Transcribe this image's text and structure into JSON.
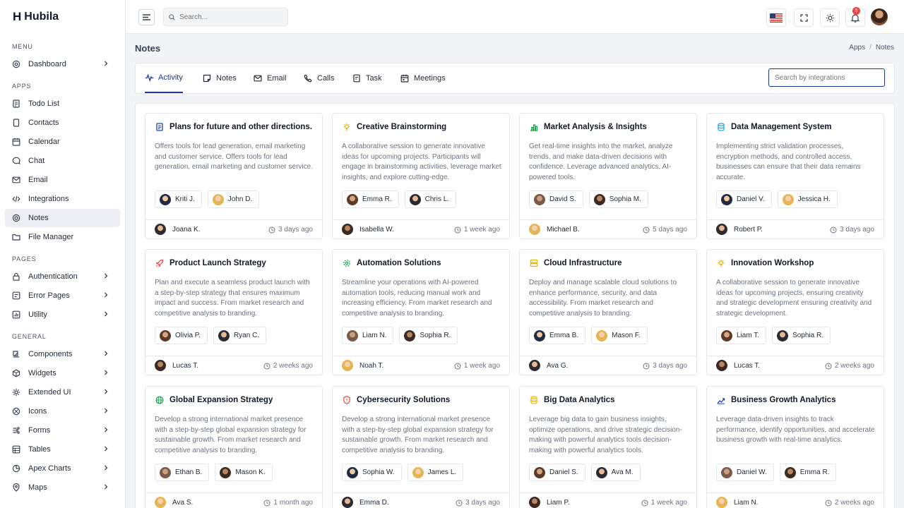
{
  "brand": {
    "name": "Hubila",
    "logo_glyph": "H"
  },
  "sidebar": {
    "sections": [
      {
        "label": "MENU",
        "items": [
          {
            "label": "Dashboard",
            "icon": "dashboard-icon",
            "chevron": true
          }
        ]
      },
      {
        "label": "APPS",
        "items": [
          {
            "label": "Todo List",
            "icon": "todo-icon",
            "chevron": false
          },
          {
            "label": "Contacts",
            "icon": "contacts-icon",
            "chevron": false
          },
          {
            "label": "Calendar",
            "icon": "calendar-icon",
            "chevron": false
          },
          {
            "label": "Chat",
            "icon": "chat-icon",
            "chevron": false
          },
          {
            "label": "Email",
            "icon": "email-icon",
            "chevron": false
          },
          {
            "label": "Integrations",
            "icon": "code-icon",
            "chevron": false
          },
          {
            "label": "Notes",
            "icon": "notes-icon",
            "chevron": false,
            "active": true
          },
          {
            "label": "File Manager",
            "icon": "folder-icon",
            "chevron": false
          }
        ]
      },
      {
        "label": "PAGES",
        "items": [
          {
            "label": "Authentication",
            "icon": "lock-icon",
            "chevron": true
          },
          {
            "label": "Error Pages",
            "icon": "error-icon",
            "chevron": true
          },
          {
            "label": "Utility",
            "icon": "utility-icon",
            "chevron": true
          }
        ]
      },
      {
        "label": "GENERAL",
        "items": [
          {
            "label": "Components",
            "icon": "components-icon",
            "chevron": true
          },
          {
            "label": "Widgets",
            "icon": "widgets-icon",
            "chevron": true
          },
          {
            "label": "Extended UI",
            "icon": "extended-icon",
            "chevron": true
          },
          {
            "label": "Icons",
            "icon": "icons-icon",
            "chevron": true
          },
          {
            "label": "Forms",
            "icon": "forms-icon",
            "chevron": true
          },
          {
            "label": "Tables",
            "icon": "table-icon",
            "chevron": true
          },
          {
            "label": "Apex Charts",
            "icon": "chart-icon",
            "chevron": true
          },
          {
            "label": "Maps",
            "icon": "map-icon",
            "chevron": true
          }
        ]
      }
    ]
  },
  "topbar": {
    "search_placeholder": "Search...",
    "notification_count": "5"
  },
  "page": {
    "title": "Notes",
    "breadcrumb": [
      "Apps",
      "Notes"
    ]
  },
  "tabs": [
    {
      "label": "Activity",
      "icon": "activity-icon",
      "active": true
    },
    {
      "label": "Notes",
      "icon": "note-icon"
    },
    {
      "label": "Email",
      "icon": "email-icon"
    },
    {
      "label": "Calls",
      "icon": "phone-icon"
    },
    {
      "label": "Task",
      "icon": "task-icon"
    },
    {
      "label": "Meetings",
      "icon": "meetings-icon"
    }
  ],
  "integration_search_placeholder": "Search by integrations",
  "colors": {
    "accent": "#1e3a8a",
    "active_bg": "#eceef3",
    "badge": "#ef4444"
  },
  "notes": [
    {
      "title": "Plans for future and other directions.",
      "icon": "document-icon",
      "icon_color": "#1e40af",
      "desc": "Offers tools for lead generation, email marketing and customer service. Offers tools for lead generation, email marketing and customer service.",
      "people": [
        "Kriti J.",
        "John D."
      ],
      "author": "Joana K.",
      "time": "3 days ago"
    },
    {
      "title": "Creative Brainstorming",
      "icon": "bulb-icon",
      "icon_color": "#eab308",
      "desc": "A collaborative session to generate innovative ideas for upcoming projects. Participants will engage in brainstorming activities, leverage market insights, and explore cutting-edge.",
      "people": [
        "Emma R.",
        "Chris L."
      ],
      "author": "Isabella W.",
      "time": "1 week ago"
    },
    {
      "title": "Market Analysis & Insights",
      "icon": "bar-chart-icon",
      "icon_color": "#16a34a",
      "desc": "Get real-time insights into the market, analyze trends, and make data-driven decisions with confidence. Leverage advanced analytics, AI-powered tools.",
      "people": [
        "David S.",
        "Sophia M."
      ],
      "author": "Michael B.",
      "time": "5 days ago"
    },
    {
      "title": "Data Management System",
      "icon": "database-icon",
      "icon_color": "#0ea5e9",
      "desc": "Implementing strict validation processes, encryption methods, and controlled access, businesses can ensure that their data remains accurate.",
      "people": [
        "Daniel V.",
        "Jessica H."
      ],
      "author": "Robert P.",
      "time": "3 days ago"
    },
    {
      "title": "Product Launch Strategy",
      "icon": "rocket-icon",
      "icon_color": "#ef4444",
      "desc": "Plan and execute a seamless product launch with a step-by-step strategy that ensures maximum impact and success. From market research and competitive analysis to branding.",
      "people": [
        "Olivia P.",
        "Ryan C."
      ],
      "author": "Lucas T.",
      "time": "2 weeks ago"
    },
    {
      "title": "Automation Solutions",
      "icon": "gear-icon",
      "icon_color": "#16a34a",
      "desc": "Streamline your operations with AI-powered automation tools, reducing manual work and increasing efficiency. From market research and competitive analysis to branding.",
      "people": [
        "Liam N.",
        "Sophia R."
      ],
      "author": "Noah T.",
      "time": "1 week ago"
    },
    {
      "title": "Cloud Infrastructure",
      "icon": "server-icon",
      "icon_color": "#eab308",
      "desc": "Deploy and manage scalable cloud solutions to enhance performance, security, and data accessibility. From market research and competitive analysis to branding.",
      "people": [
        "Emma B.",
        "Mason F."
      ],
      "author": "Ava G.",
      "time": "3 days ago"
    },
    {
      "title": "Innovation Workshop",
      "icon": "bulb-icon",
      "icon_color": "#eab308",
      "desc": "A collaborative session to generate innovative ideas for upcoming projects, ensuring creativity and strategic development ensuring creativity and strategic development.",
      "people": [
        "Liam T.",
        "Sophia R."
      ],
      "author": "Lucas T.",
      "time": "2 weeks ago"
    },
    {
      "title": "Global Expansion Strategy",
      "icon": "globe-icon",
      "icon_color": "#16a34a",
      "desc": "Develop a strong international market presence with a step-by-step global expansion strategy for sustainable growth. From market research and competitive analysis to branding.",
      "people": [
        "Ethan B.",
        "Mason K."
      ],
      "author": "Ava S.",
      "time": "1 month ago"
    },
    {
      "title": "Cybersecurity Solutions",
      "icon": "shield-icon",
      "icon_color": "#ef4444",
      "desc": "Develop a strong international market presence with a step-by-step global expansion strategy for sustainable growth. From market research and competitive analysis to branding.",
      "people": [
        "Sophia W.",
        "James L."
      ],
      "author": "Emma D.",
      "time": "3 days ago"
    },
    {
      "title": "Big Data Analytics",
      "icon": "database-icon",
      "icon_color": "#eab308",
      "desc": "Leverage big data to gain business insights, optimize operations, and drive strategic decision-making with powerful analytics tools decision-making with powerful analytics tools.",
      "people": [
        "Daniel S.",
        "Ava M."
      ],
      "author": "Liam P.",
      "time": "1 week ago"
    },
    {
      "title": "Business Growth Analytics",
      "icon": "trend-icon",
      "icon_color": "#1e40af",
      "desc": "Leverage data-driven insights to track performance, identify opportunities, and accelerate business growth with real-time analytics.",
      "people": [
        "Daniel W.",
        "Emma R."
      ],
      "author": "Liam N.",
      "time": "2 weeks ago"
    }
  ]
}
